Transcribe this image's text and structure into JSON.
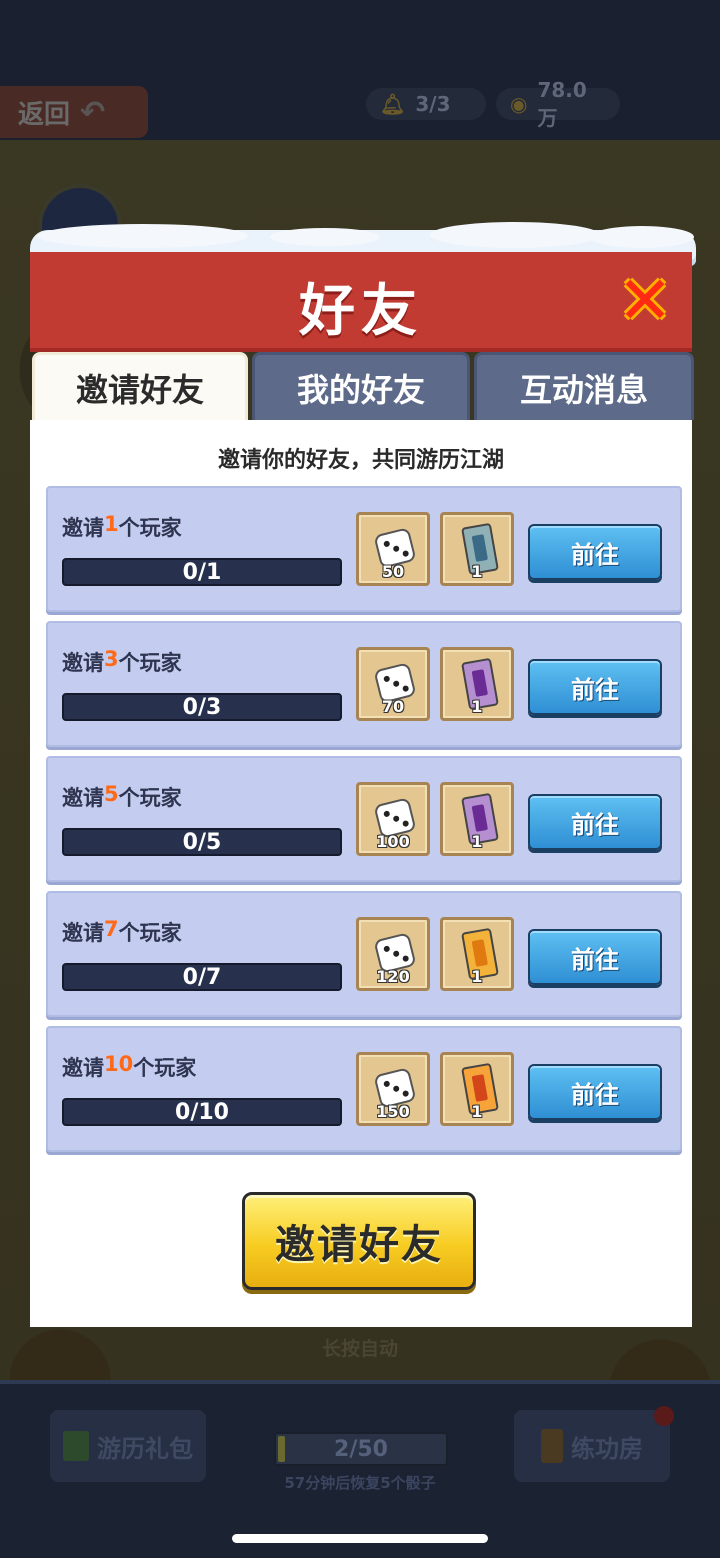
{
  "game": {
    "back_label": "返回",
    "bell_count": "3/3",
    "coins": "78.0万",
    "hold_auto": "长按自动",
    "gift_label": "游历礼包",
    "dice_counter": "2/50",
    "dice_progress": 0.04,
    "dice_recover": "57分钟后恢复5个骰子",
    "practice_label": "练功房"
  },
  "modal": {
    "title": "好友",
    "close_icon": "close-icon",
    "tabs": [
      {
        "label": "邀请好友",
        "active": true
      },
      {
        "label": "我的好友",
        "active": false
      },
      {
        "label": "互动消息",
        "active": false
      }
    ],
    "subtitle": "邀请你的好友，共同游历江湖",
    "rows": [
      {
        "prefix": "邀请",
        "num": "1",
        "suffix": "个玩家",
        "progress": "0/1",
        "dice": "50",
        "card": "1",
        "card_color": "#8fb0b4",
        "card_inner": "#3a6a86",
        "go": "前往"
      },
      {
        "prefix": "邀请",
        "num": "3",
        "suffix": "个玩家",
        "progress": "0/3",
        "dice": "70",
        "card": "1",
        "card_color": "#b58fd0",
        "card_inner": "#6a2c94",
        "go": "前往"
      },
      {
        "prefix": "邀请",
        "num": "5",
        "suffix": "个玩家",
        "progress": "0/5",
        "dice": "100",
        "card": "1",
        "card_color": "#b58fd0",
        "card_inner": "#6a2c94",
        "go": "前往"
      },
      {
        "prefix": "邀请",
        "num": "7",
        "suffix": "个玩家",
        "progress": "0/7",
        "dice": "120",
        "card": "1",
        "card_color": "#f3b23a",
        "card_inner": "#e07a10",
        "go": "前往"
      },
      {
        "prefix": "邀请",
        "num": "10",
        "suffix": "个玩家",
        "progress": "0/10",
        "dice": "150",
        "card": "1",
        "card_color": "#f6a43a",
        "card_inner": "#d2461a",
        "go": "前往"
      }
    ],
    "invite_button": "邀请好友"
  }
}
